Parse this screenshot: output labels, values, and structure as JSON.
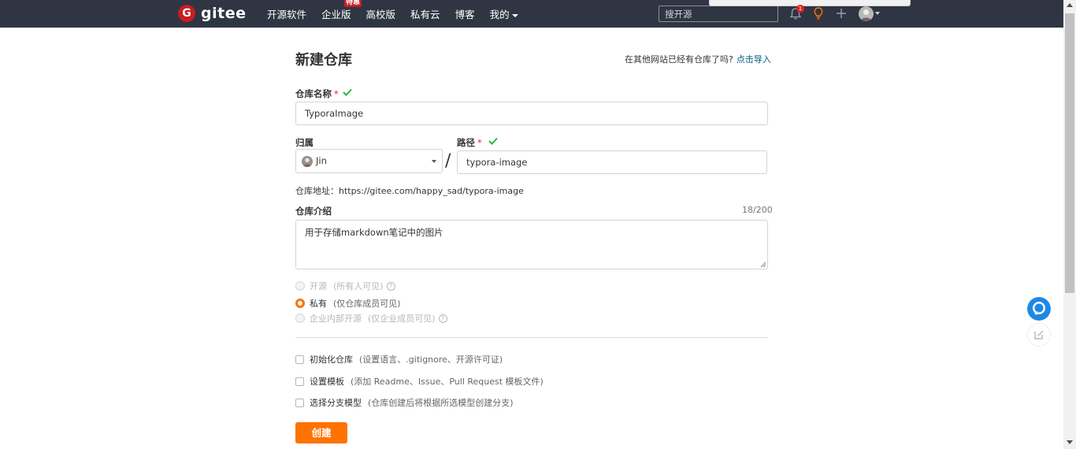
{
  "brand": {
    "logo_letter": "G",
    "name": "gitee"
  },
  "nav": {
    "items": [
      "开源软件",
      "企业版",
      "高校版",
      "私有云",
      "博客",
      "我的"
    ],
    "hot_badge": "特惠",
    "search_placeholder": "搜开源",
    "notification_count": "1"
  },
  "page": {
    "title": "新建仓库",
    "import_prompt": "在其他网站已经有仓库了吗?",
    "import_link": "点击导入"
  },
  "form": {
    "repo_name_label": "仓库名称",
    "required_mark": "*",
    "repo_name_value": "TyporaImage",
    "owner_label": "归属",
    "owner_value": "Jin",
    "separator": "/",
    "path_label": "路径",
    "path_value": "typora-image",
    "address_text": "仓库地址：https://gitee.com/happy_sad/typora-image",
    "desc_label": "仓库介绍",
    "desc_counter": "18/200",
    "desc_value": "用于存储markdown笔记中的图片",
    "visibility": [
      {
        "label": "开源",
        "sub": "(所有人可见)",
        "selected": false,
        "enabled": false,
        "help": true
      },
      {
        "label": "私有",
        "sub": "(仅仓库成员可见)",
        "selected": true,
        "enabled": true,
        "help": false
      },
      {
        "label": "企业内部开源",
        "sub": "(仅企业成员可见)",
        "selected": false,
        "enabled": false,
        "help": true
      }
    ],
    "options": [
      {
        "label": "初始化仓库",
        "sub": "(设置语言、.gitignore、开源许可证)",
        "checked": false
      },
      {
        "label": "设置模板",
        "sub": "(添加 Readme、Issue、Pull Request 模板文件)",
        "checked": false
      },
      {
        "label": "选择分支模型",
        "sub": "(仓库创建后将根据所选模型创建分支)",
        "checked": false
      }
    ],
    "submit_label": "创建"
  },
  "colors": {
    "accent": "#fe7300",
    "navbar": "#2f3542",
    "brand_red": "#c71d23",
    "success": "#21ba45",
    "link": "#005980"
  }
}
